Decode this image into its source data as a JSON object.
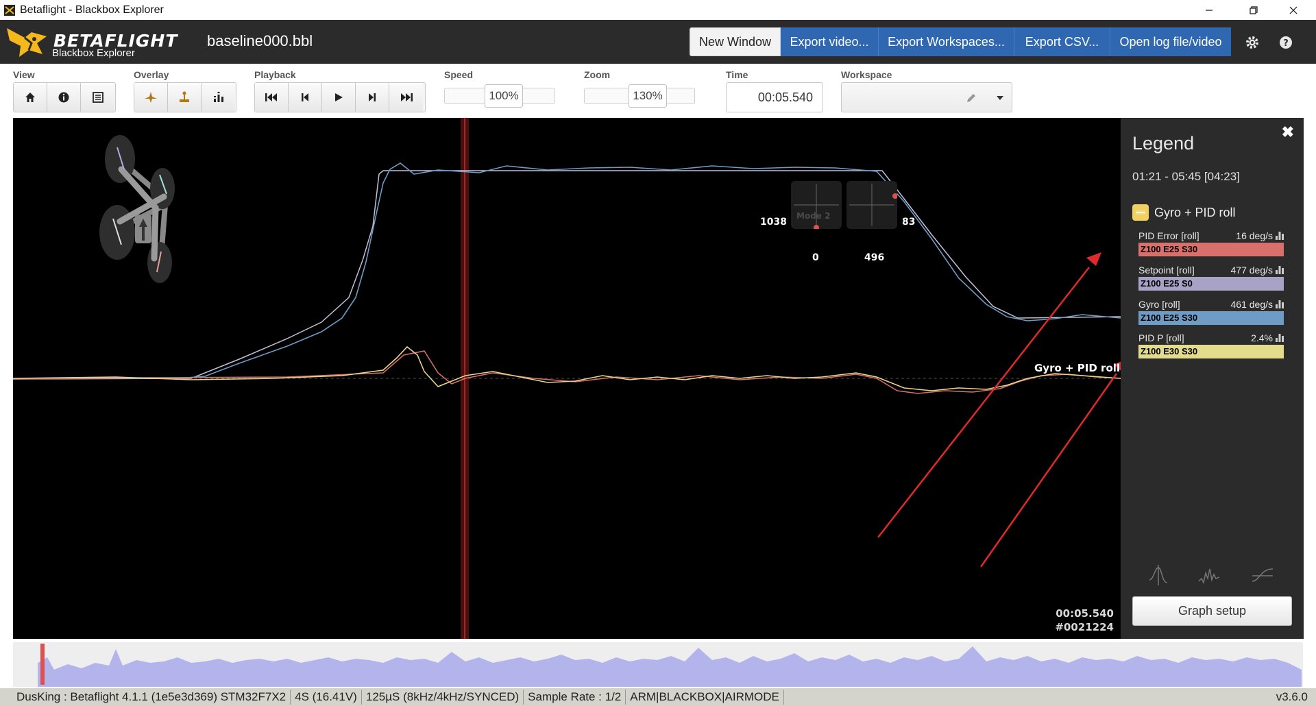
{
  "window": {
    "title": "Betaflight - Blackbox Explorer"
  },
  "header": {
    "brand": "BETAFLIGHT",
    "subtitle": "Blackbox Explorer",
    "filename": "baseline000.bbl",
    "buttons": {
      "new_window": "New Window",
      "export_video": "Export video...",
      "export_workspaces": "Export Workspaces...",
      "export_csv": "Export CSV...",
      "open_log": "Open log file/video"
    },
    "icons": [
      "gear-icon",
      "help-icon"
    ]
  },
  "toolbar": {
    "view_label": "View",
    "overlay_label": "Overlay",
    "playback_label": "Playback",
    "speed_label": "Speed",
    "zoom_label": "Zoom",
    "time_label": "Time",
    "workspace_label": "Workspace",
    "speed_value": "100%",
    "zoom_value": "130%",
    "time_value": "00:05.540",
    "view_icons": [
      "home-icon",
      "info-icon",
      "list-icon"
    ],
    "overlay_icons": [
      "craft-icon",
      "sticks-icon",
      "analyser-icon"
    ],
    "playback_icons": [
      "skip-start-icon",
      "step-back-icon",
      "play-icon",
      "step-forward-icon",
      "skip-end-icon"
    ]
  },
  "graph": {
    "stick_left_y": "1038",
    "stick_left_x": "0",
    "stick_right_x": "496",
    "stick_right_y": "83",
    "mode_label": "Mode 2",
    "group_label": "Gyro + PID roll",
    "time": "00:05.540",
    "frame": "#0021224"
  },
  "legend": {
    "title": "Legend",
    "range": "01:21 - 05:45 [04:23]",
    "group": "Gyro + PID roll",
    "items": [
      {
        "name": "PID Error [roll]",
        "value": "16 deg/s",
        "curve": "Z100 E25 S30",
        "color": "#d9706b"
      },
      {
        "name": "Setpoint [roll]",
        "value": "477 deg/s",
        "curve": "Z100 E25 S0",
        "color": "#a7a2c6"
      },
      {
        "name": "Gyro [roll]",
        "value": "461 deg/s",
        "curve": "Z100 E25 S30",
        "color": "#6f9cc4"
      },
      {
        "name": "PID P [roll]",
        "value": "2.4%",
        "curve": "Z100 E30 S30",
        "color": "#e3dc8c"
      }
    ],
    "graph_setup": "Graph setup"
  },
  "status": {
    "segments": [
      "DusKing : Betaflight 4.1.1 (1e5e3d369) STM32F7X2",
      "4S (16.41V)",
      "125µS (8kHz/4kHz/SYNCED)",
      "Sample Rate : 1/2",
      "ARM|BLACKBOX|AIRMODE"
    ],
    "version": "v3.6.0"
  },
  "colors": {
    "accent_blue": "#2f67b0",
    "header_bg": "#2b2b2b",
    "cursor_red": "#a02020",
    "annotation_arrow": "#e02a2a"
  }
}
